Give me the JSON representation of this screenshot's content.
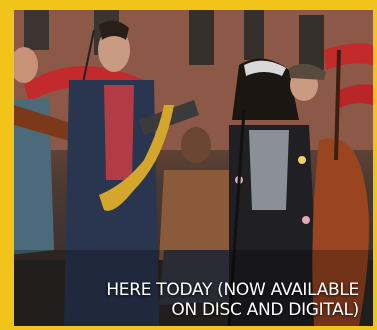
{
  "image": {
    "scene": "street band photo with performers and instruments",
    "caption_line_1": "HERE TODAY (NOW AVAILABLE",
    "caption_line_2": "ON DISC AND DIGITAL)"
  },
  "colors": {
    "frame": "#f2c318",
    "caption_text": "#ffffff"
  }
}
